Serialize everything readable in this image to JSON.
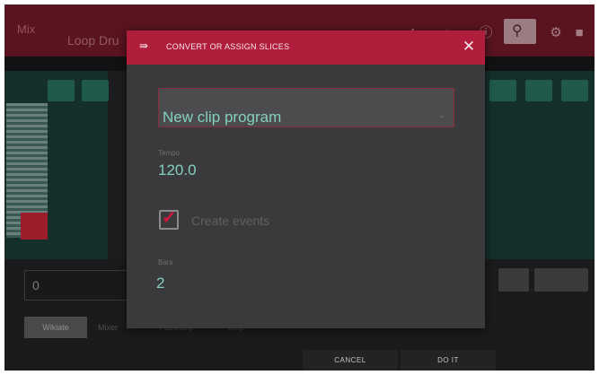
{
  "background": {
    "title": "Mix",
    "subtitle": "Loop Dru",
    "field_value": "0",
    "tabs": [
      "Wikiate",
      "Mixer",
      "Pads/Clip",
      "Step"
    ],
    "icons": [
      "slider-icon",
      "timer-icon",
      "info-icon",
      "search-icon",
      "gear-icon",
      "stop-icon"
    ]
  },
  "dialog": {
    "title": "CONVERT OR ASSIGN SLICES",
    "icon": "slice-arrow-icon",
    "close_glyph": "✕",
    "dropdown_value": "New clip program",
    "tempo_label": "Tempo",
    "tempo_value": "120.0",
    "create_events_label": "Create events",
    "create_events_checked": true,
    "bars_label": "Bars",
    "bars_value": "2"
  },
  "footer": {
    "cancel_label": "CANCEL",
    "doit_label": "DO IT"
  },
  "colors": {
    "accent": "#b01e3c",
    "teal_value": "#83d0bd",
    "dialog_bg": "#3a3a3c"
  }
}
